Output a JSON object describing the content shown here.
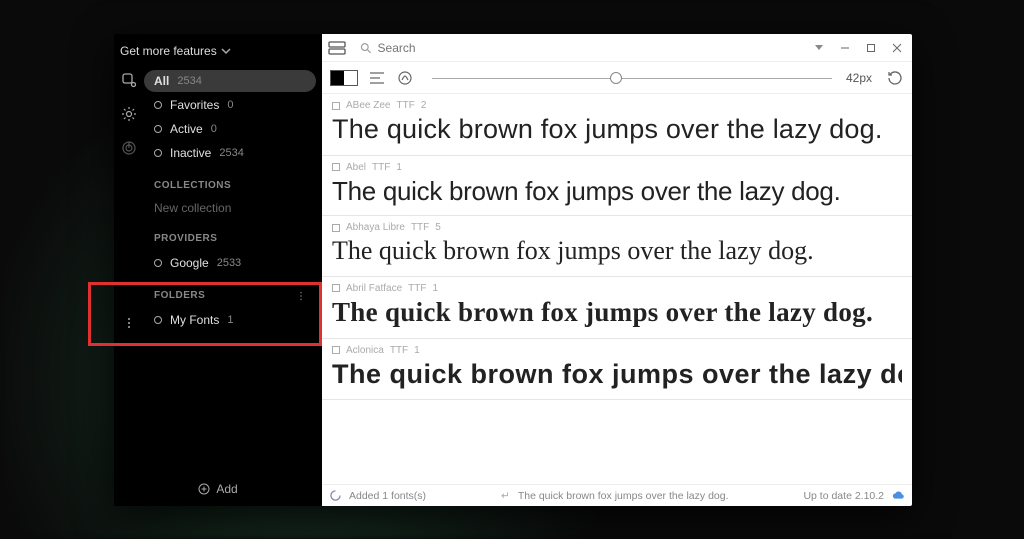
{
  "header": {
    "get_more": "Get more features"
  },
  "filters": {
    "all": {
      "label": "All",
      "count": "2534"
    },
    "favorites": {
      "label": "Favorites",
      "count": "0"
    },
    "active": {
      "label": "Active",
      "count": "0"
    },
    "inactive": {
      "label": "Inactive",
      "count": "2534"
    }
  },
  "sections": {
    "collections": "COLLECTIONS",
    "new_collection": "New collection",
    "providers": "PROVIDERS",
    "folders": "FOLDERS"
  },
  "providers": {
    "google": {
      "label": "Google",
      "count": "2533"
    }
  },
  "folders": {
    "myfonts": {
      "label": "My Fonts",
      "count": "1"
    }
  },
  "footer": {
    "add": "Add"
  },
  "search": {
    "placeholder": "Search"
  },
  "toolbar": {
    "size": "42px"
  },
  "sample_text": "The quick brown fox jumps over the lazy dog.",
  "fonts": {
    "abeezee": {
      "name": "ABee Zee",
      "format": "TTF",
      "styles": "2"
    },
    "abel": {
      "name": "Abel",
      "format": "TTF",
      "styles": "1"
    },
    "abhaya": {
      "name": "Abhaya Libre",
      "format": "TTF",
      "styles": "5"
    },
    "abril": {
      "name": "Abril Fatface",
      "format": "TTF",
      "styles": "1"
    },
    "aclonica": {
      "name": "Aclonica",
      "format": "TTF",
      "styles": "1"
    }
  },
  "status": {
    "added": "Added 1 fonts(s)",
    "preview": "The quick brown fox jumps over the lazy dog.",
    "uptodate": "Up to date 2.10.2"
  }
}
